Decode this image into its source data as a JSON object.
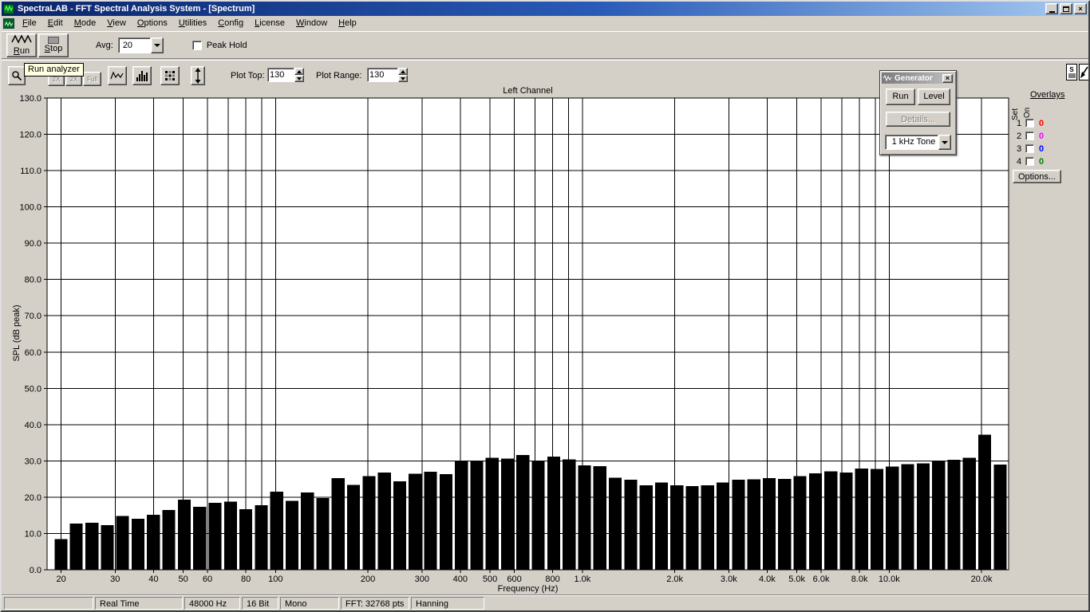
{
  "window": {
    "title": "SpectraLAB - FFT Spectral Analysis System - [Spectrum]",
    "close_glyph": "×"
  },
  "menu": {
    "items": [
      "File",
      "Edit",
      "Mode",
      "View",
      "Options",
      "Utilities",
      "Config",
      "License",
      "Window",
      "Help"
    ]
  },
  "toolbar": {
    "run": "Run",
    "stop": "Stop",
    "avg_label": "Avg:",
    "avg_value": "20",
    "peak_hold": "Peak Hold"
  },
  "toolbar2": {
    "zoom": [
      "2X",
      "2X",
      "Full"
    ],
    "plot_top_label": "Plot Top:",
    "plot_top_value": "130",
    "plot_range_label": "Plot Range:",
    "plot_range_value": "130"
  },
  "tooltip": "Run analyzer",
  "generator": {
    "title": "Generator",
    "run": "Run",
    "level": "Level",
    "details": "Details...",
    "signal": "1 kHz Tone"
  },
  "overlays": {
    "title": "Overlays",
    "col_set": "Set",
    "col_on": "On",
    "rows": [
      {
        "num": "1",
        "value": "0",
        "color": "#ff0000"
      },
      {
        "num": "2",
        "value": "0",
        "color": "#ff00ff"
      },
      {
        "num": "3",
        "value": "0",
        "color": "#0000ff"
      },
      {
        "num": "4",
        "value": "0",
        "color": "#008000"
      }
    ],
    "options": "Options..."
  },
  "statusbar": {
    "fields": [
      "Real Time",
      "48000 Hz",
      "16 Bit",
      "Mono",
      "FFT: 32768 pts",
      "Hanning"
    ]
  },
  "chart_data": {
    "type": "bar",
    "title": "Left Channel",
    "xlabel": "Frequency (Hz)",
    "ylabel": "SPL (dB peak)",
    "x_scale": "log",
    "xlim": [
      18,
      24500
    ],
    "ylim": [
      0,
      130
    ],
    "ytick_step": 10,
    "grid": true,
    "bar_color": "#000000",
    "bar_octave_fraction": 6,
    "x_gridlines": [
      20,
      30,
      40,
      50,
      60,
      70,
      80,
      90,
      100,
      200,
      300,
      400,
      500,
      600,
      700,
      800,
      900,
      1000,
      2000,
      3000,
      4000,
      5000,
      6000,
      7000,
      8000,
      9000,
      10000,
      20000
    ],
    "x_ticks": [
      {
        "f": 20,
        "label": "20"
      },
      {
        "f": 30,
        "label": "30"
      },
      {
        "f": 40,
        "label": "40"
      },
      {
        "f": 50,
        "label": "50"
      },
      {
        "f": 60,
        "label": "60"
      },
      {
        "f": 80,
        "label": "80"
      },
      {
        "f": 100,
        "label": "100"
      },
      {
        "f": 200,
        "label": "200"
      },
      {
        "f": 300,
        "label": "300"
      },
      {
        "f": 400,
        "label": "400"
      },
      {
        "f": 500,
        "label": "500"
      },
      {
        "f": 600,
        "label": "600"
      },
      {
        "f": 800,
        "label": "800"
      },
      {
        "f": 1000,
        "label": "1.0k"
      },
      {
        "f": 2000,
        "label": "2.0k"
      },
      {
        "f": 3000,
        "label": "3.0k"
      },
      {
        "f": 4000,
        "label": "4.0k"
      },
      {
        "f": 5000,
        "label": "5.0k"
      },
      {
        "f": 6000,
        "label": "6.0k"
      },
      {
        "f": 8000,
        "label": "8.0k"
      },
      {
        "f": 10000,
        "label": "10.0k"
      },
      {
        "f": 20000,
        "label": "20.0k"
      }
    ],
    "frequencies": [
      20,
      22.4,
      25.2,
      28.3,
      31.7,
      35.6,
      40,
      44.9,
      50.4,
      56.6,
      63.5,
      71.3,
      80,
      89.8,
      100.8,
      113.1,
      127,
      142.5,
      160,
      179.6,
      201.6,
      226.3,
      254,
      285.1,
      320,
      359.2,
      403.2,
      452.5,
      508,
      570.2,
      640,
      718.4,
      806.3,
      905.1,
      1015.9,
      1140.4,
      1280,
      1436.8,
      1612.7,
      1810.2,
      2031.9,
      2280.7,
      2560,
      2873.5,
      3225.4,
      3620.4,
      4063.7,
      4561.4,
      5120,
      5747,
      6450.8,
      7240.8,
      8127.5,
      9122.8,
      10240,
      11494,
      12901.6,
      14481.5,
      16255,
      18245.6,
      20480,
      22988
    ],
    "values": [
      8.5,
      12.7,
      13.0,
      12.3,
      14.8,
      14.0,
      15.2,
      16.5,
      19.3,
      17.3,
      18.4,
      18.8,
      16.7,
      17.8,
      21.5,
      19.0,
      21.3,
      19.8,
      25.3,
      23.4,
      25.8,
      26.8,
      24.4,
      26.5,
      27.0,
      26.4,
      29.9,
      30.0,
      30.9,
      30.6,
      31.6,
      30.0,
      31.2,
      30.4,
      28.8,
      28.6,
      25.4,
      24.8,
      23.3,
      24.0,
      23.3,
      23.1,
      23.3,
      24.0,
      24.8,
      24.9,
      25.3,
      25.0,
      25.8,
      26.6,
      27.1,
      26.8,
      27.9,
      27.8,
      28.4,
      29.1,
      29.3,
      30.0,
      30.3,
      30.9,
      37.2,
      29.0
    ]
  }
}
